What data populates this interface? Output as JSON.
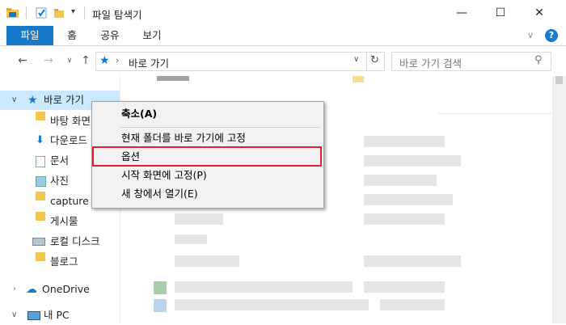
{
  "window": {
    "title": "파일 탐색기",
    "minimize": "—",
    "maximize": "☐",
    "close": "✕"
  },
  "ribbon": {
    "tabs": [
      {
        "label": "파일"
      },
      {
        "label": "홈"
      },
      {
        "label": "공유"
      },
      {
        "label": "보기"
      }
    ],
    "collapse_icon": "chevron-down-icon",
    "help_icon": "help-icon",
    "help_label": "?",
    "accent": "#1979ca"
  },
  "address": {
    "path": "바로 가기",
    "search_placeholder": "바로 가기 검색"
  },
  "nav": {
    "quick_access": "바로 가기",
    "items": [
      {
        "label": "바탕 화면"
      },
      {
        "label": "다운로드"
      },
      {
        "label": "문서"
      },
      {
        "label": "사진"
      },
      {
        "label": "capture"
      },
      {
        "label": "게시물"
      },
      {
        "label": "로컬 디스크"
      },
      {
        "label": "블로그"
      }
    ],
    "onedrive": "OneDrive",
    "this_pc": "내 PC"
  },
  "context_menu": {
    "items": [
      {
        "label": "축소(A)",
        "bold": true
      },
      {
        "label": "현재 폴더를 바로 가기에 고정"
      },
      {
        "label": "옵션"
      },
      {
        "label": "시작 화면에 고정(P)"
      },
      {
        "label": "새 창에서 열기(E)"
      }
    ],
    "highlight_color": "#e0212a"
  }
}
